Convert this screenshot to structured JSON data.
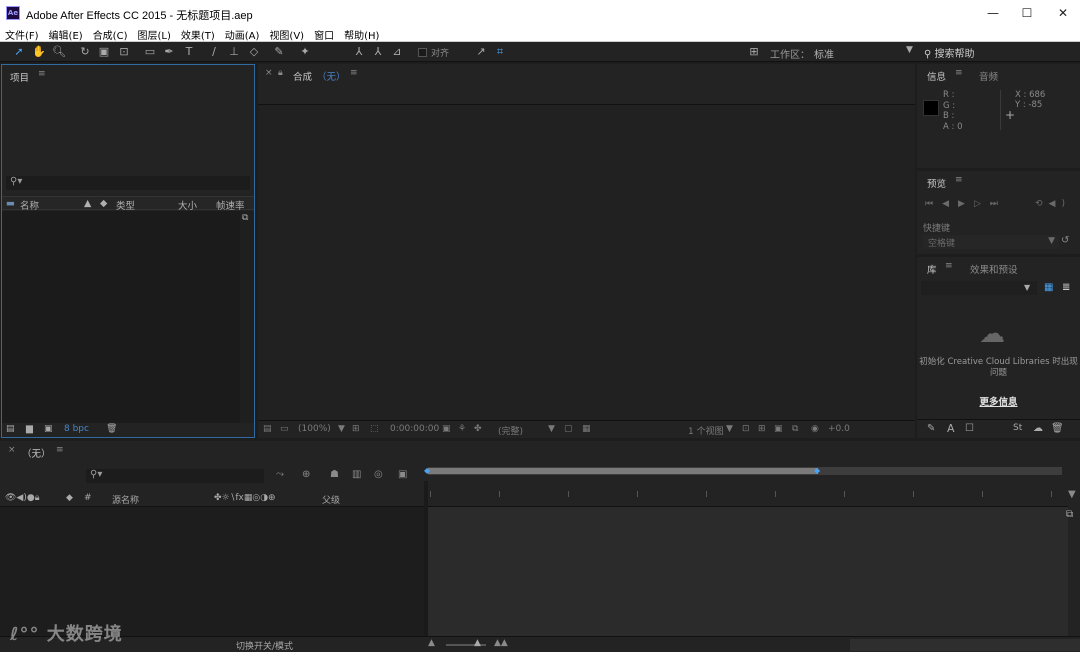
{
  "window": {
    "title": "Adobe After Effects CC 2015 - 无标题项目.aep",
    "logo": "Ae"
  },
  "menu": [
    "文件(F)",
    "编辑(E)",
    "合成(C)",
    "图层(L)",
    "效果(T)",
    "动画(A)",
    "视图(V)",
    "窗口",
    "帮助(H)"
  ],
  "toolbar": {
    "snap_label": "对齐",
    "workspace_label": "工作区：",
    "workspace_value": "标准",
    "search_help": "搜索帮助"
  },
  "project_panel": {
    "title": "项目",
    "columns": [
      "名称",
      "类型",
      "大小",
      "帧速率"
    ],
    "bpc": "8 bpc"
  },
  "composition_panel": {
    "tab_label": "合成",
    "tab_value": "（无）",
    "zoom": "(100%)",
    "timecode": "0:00:00:00",
    "resolution": "(完整)",
    "views": "1 个视图",
    "exposure": "+0.0"
  },
  "info_panel": {
    "tabs": [
      "信息",
      "音频"
    ],
    "r": "R :",
    "g": "G :",
    "b": "B :",
    "a": "A : 0",
    "x": "X : 686",
    "y": "Y : -85"
  },
  "preview_panel": {
    "title": "预览",
    "shortcut_label": "快捷键",
    "shortcut_value": "空格键"
  },
  "library_panel": {
    "tabs": [
      "库",
      "效果和预设"
    ],
    "message": "初始化 Creative Cloud Libraries 时出现问题",
    "more_info": "更多信息"
  },
  "timeline": {
    "tab_label": "（无）",
    "col_source": "源名称",
    "col_parent": "父级",
    "col_num": "#",
    "footer_switch": "切换开关/模式"
  },
  "watermark": "大数跨境"
}
